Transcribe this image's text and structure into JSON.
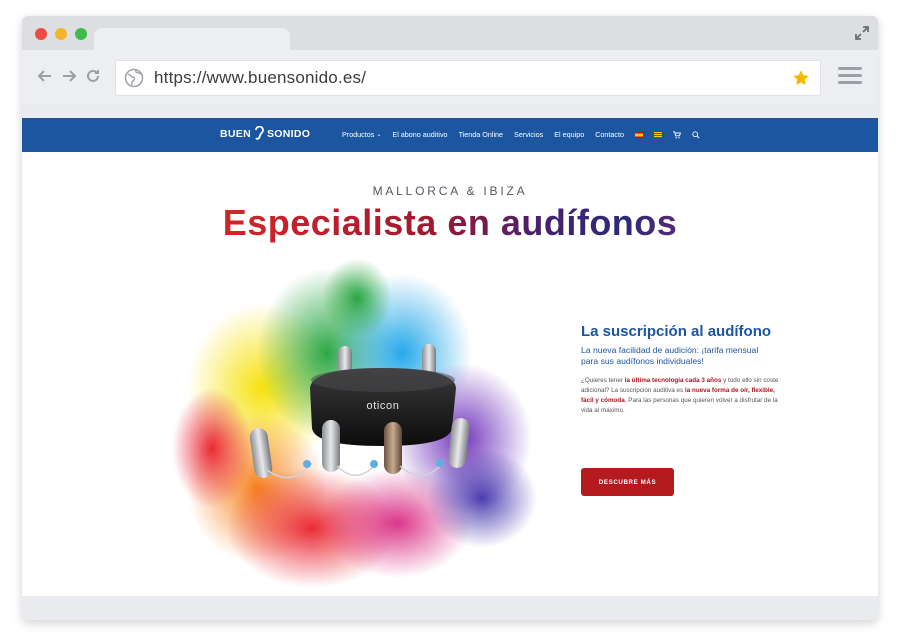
{
  "browser": {
    "url": "https://www.buensonido.es/",
    "accent_star_color": "#f5b800"
  },
  "site": {
    "logo_left": "BUEN",
    "logo_right": "SONIDO",
    "brand_color": "#1c56a0",
    "nav": [
      {
        "label": "Productos",
        "has_caret": true
      },
      {
        "label": "El abono auditivo"
      },
      {
        "label": "Tienda Online"
      },
      {
        "label": "Servicios"
      },
      {
        "label": "El equipo"
      },
      {
        "label": "Contacto"
      }
    ],
    "nav_icons": [
      "flag-es-icon",
      "flag-ca-icon",
      "cart-icon",
      "search-icon"
    ]
  },
  "hero": {
    "kicker": "MALLORCA & IBIZA",
    "headline": "Especialista en audífonos",
    "product_brand": "oticon"
  },
  "promo": {
    "title": "La suscripción al audífono",
    "subtitle": "La nueva facilidad de audición: ¡tarifa mensual para sus audífonos individuales!",
    "body_1": "¿Quieres tener ",
    "body_hl_1": "la última tecnología cada 3 años",
    "body_2": " y todo ello sin coste adicional? La suscripción auditiva es ",
    "body_hl_2": "la nueva forma de oír, flexible, fácil y cómoda",
    "body_3": ". Para las personas que quieren volver a disfrutar de la vida al máximo.",
    "cta_label": "DESCUBRE MÁS",
    "cta_color": "#b51a1f"
  }
}
